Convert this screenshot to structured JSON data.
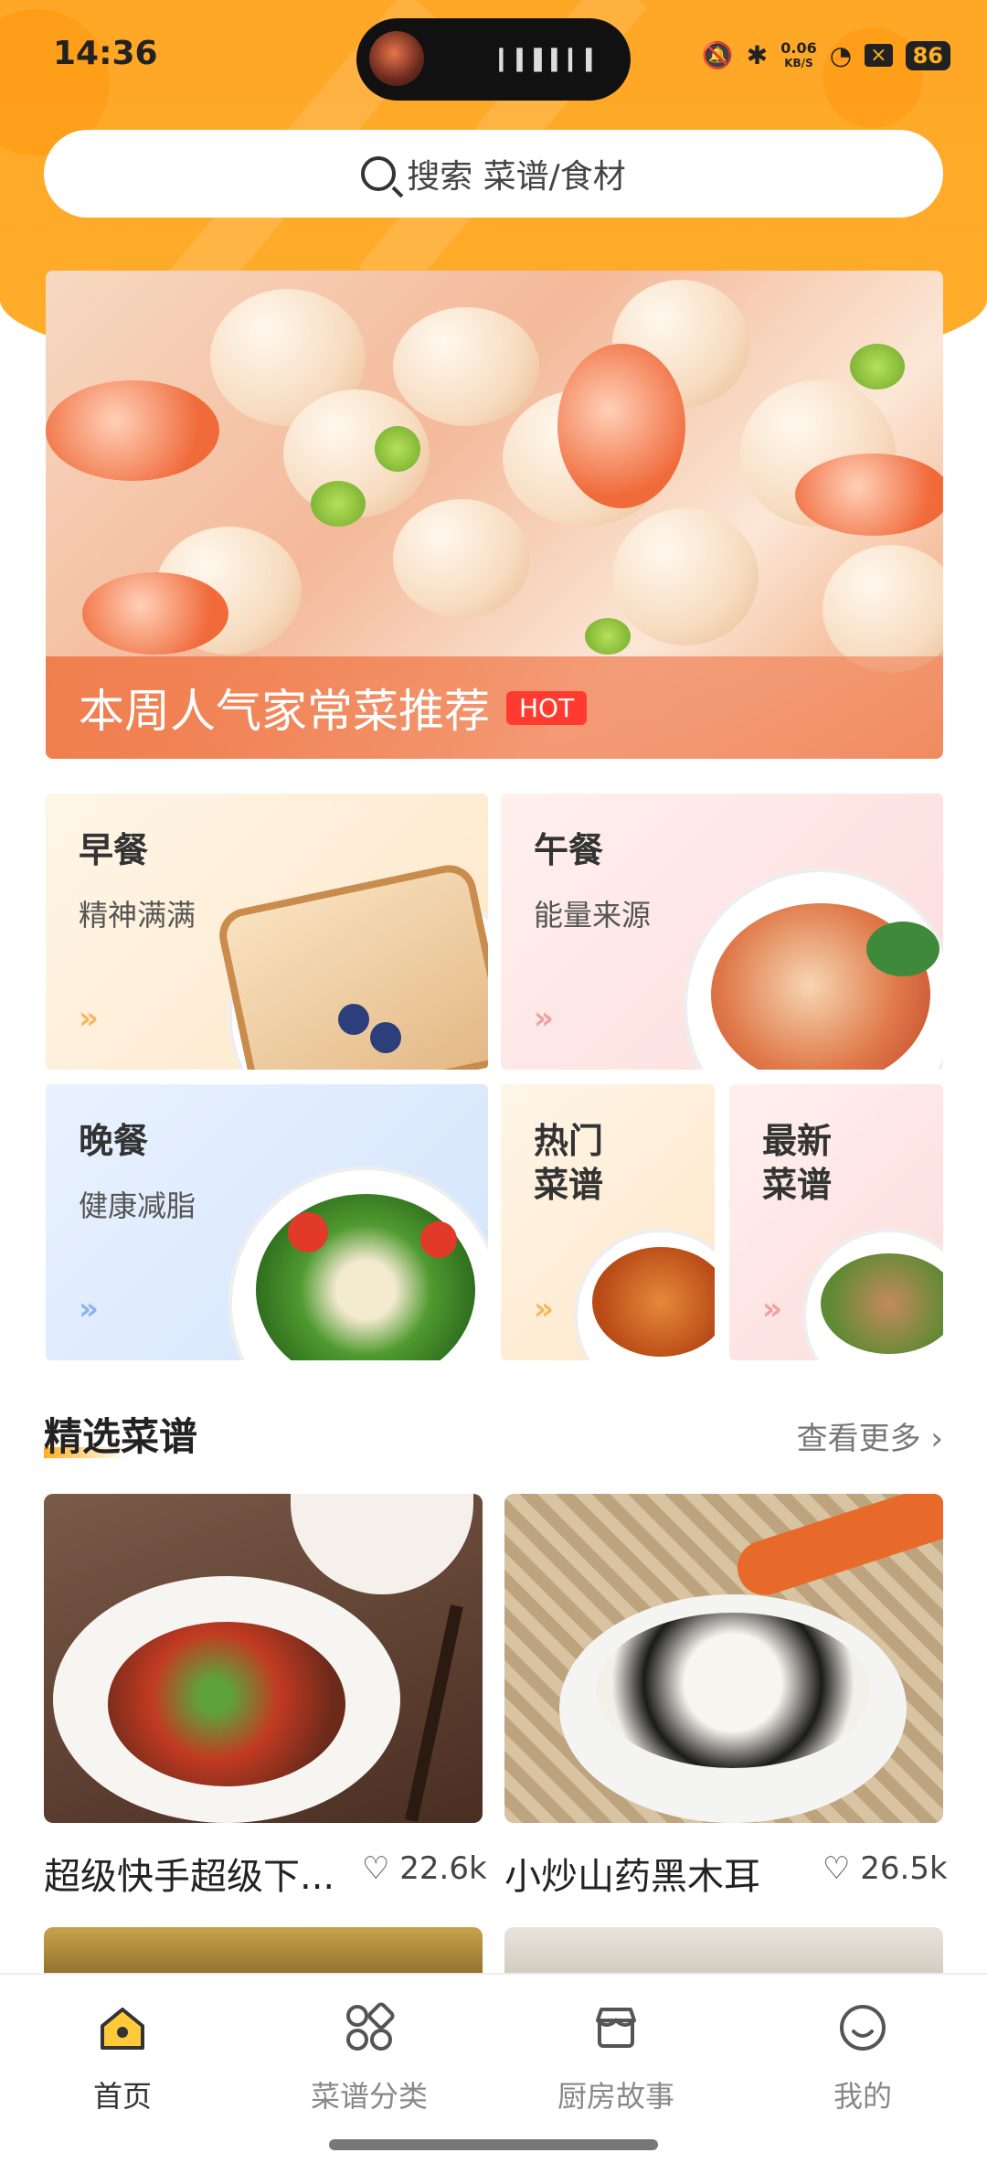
{
  "status": {
    "time": "14:36",
    "net_speed": "0.06",
    "net_unit": "KB/S",
    "battery": "86"
  },
  "search": {
    "placeholder": "搜索 菜谱/食材"
  },
  "banner": {
    "title": "本周人气家常菜推荐",
    "badge": "HOT"
  },
  "categories": [
    {
      "title": "早餐",
      "subtitle": "精神满满",
      "color": "#f5a623"
    },
    {
      "title": "午餐",
      "subtitle": "能量来源",
      "color": "#f08a8a"
    },
    {
      "title": "晚餐",
      "subtitle": "健康减脂",
      "color": "#6a9ce8"
    },
    {
      "title": "热门\n菜谱",
      "color": "#f5a623"
    },
    {
      "title": "最新\n菜谱",
      "color": "#f08a8a"
    }
  ],
  "featured": {
    "title": "精选菜谱",
    "more": "查看更多"
  },
  "recipes": [
    {
      "name": "超级快手超级下...",
      "likes": "22.6k"
    },
    {
      "name": "小炒山药黑木耳",
      "likes": "26.5k"
    }
  ],
  "tabs": [
    {
      "label": "首页",
      "icon": "home-icon"
    },
    {
      "label": "菜谱分类",
      "icon": "category-icon"
    },
    {
      "label": "厨房故事",
      "icon": "store-icon"
    },
    {
      "label": "我的",
      "icon": "smile-icon"
    }
  ]
}
